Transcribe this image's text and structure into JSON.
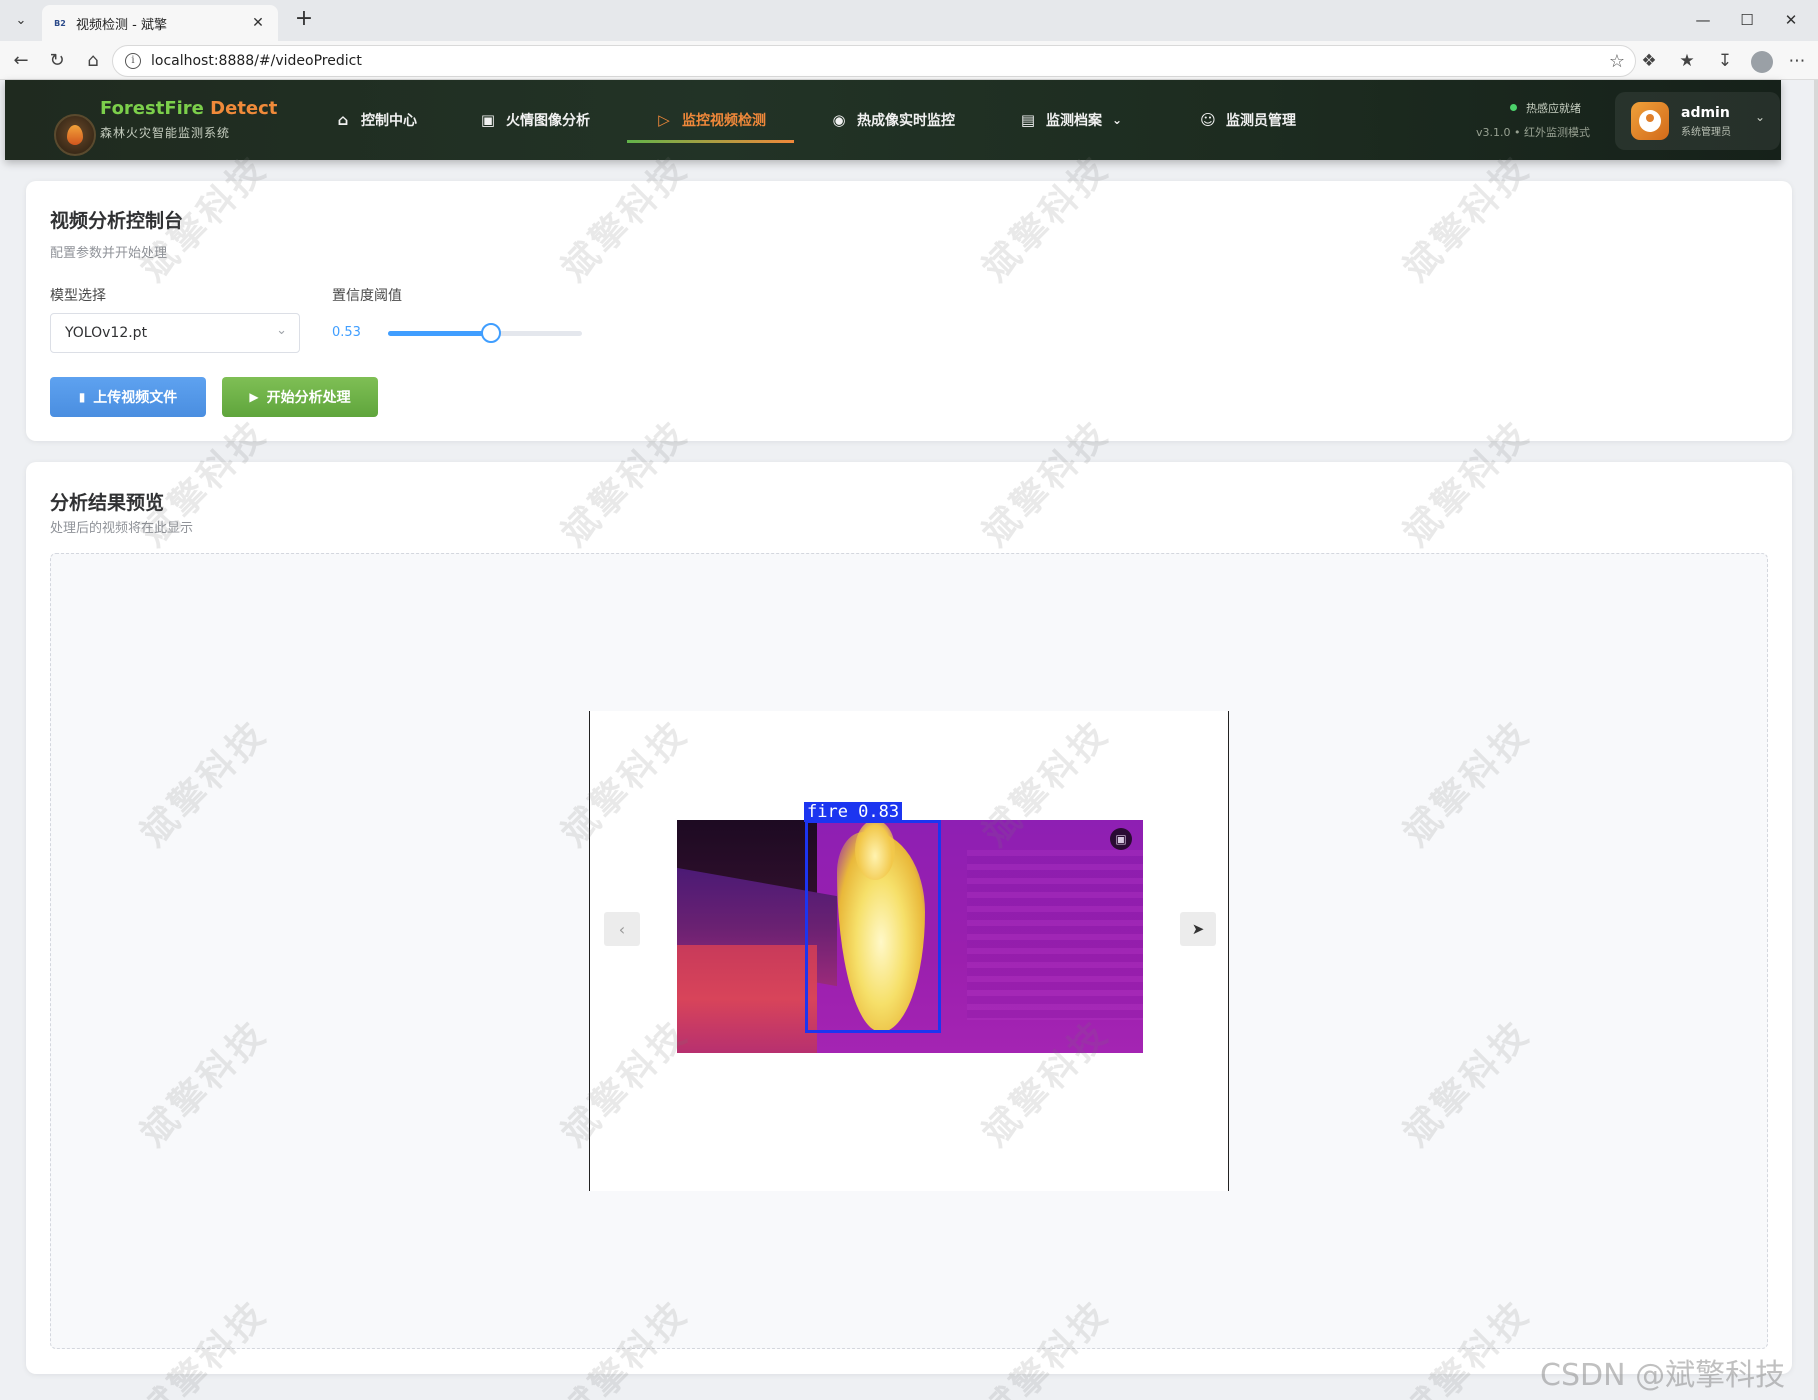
{
  "browser": {
    "tab_title": "视频检测 - 斌擎",
    "favicon_text": "B2",
    "url": "localhost:8888/#/videoPredict"
  },
  "brand": {
    "title_part1": "ForestFire",
    "title_part2": "Detect",
    "subtitle": "森林火灾智能监测系统"
  },
  "nav": {
    "items": [
      {
        "label": "控制中心",
        "icon": "home-icon"
      },
      {
        "label": "火情图像分析",
        "icon": "image-icon"
      },
      {
        "label": "监控视频检测",
        "icon": "video-play-icon",
        "active": true
      },
      {
        "label": "热成像实时监控",
        "icon": "camera-icon"
      },
      {
        "label": "监测档案",
        "icon": "document-icon",
        "has_dropdown": true
      },
      {
        "label": "监测员管理",
        "icon": "user-icon"
      }
    ]
  },
  "status": {
    "text": "热感应就绪",
    "version": "v3.1.0 • 红外监测模式"
  },
  "user": {
    "name": "admin",
    "role": "系统管理员"
  },
  "control_panel": {
    "title": "视频分析控制台",
    "subtitle": "配置参数并开始处理",
    "model_label": "模型选择",
    "model_value": "YOLOv12.pt",
    "confidence_label": "置信度阈值",
    "confidence_value": "0.53",
    "confidence_fraction": 0.53,
    "upload_button": "上传视频文件",
    "start_button": "开始分析处理"
  },
  "result_panel": {
    "title": "分析结果预览",
    "subtitle": "处理后的视频将在此显示"
  },
  "detection": {
    "label": "fire 0.83"
  },
  "watermark": {
    "text": "斌擎科技",
    "footer": "CSDN @斌擎科技"
  },
  "colors": {
    "accent_active": "#f0883a",
    "brand_green": "#7ccf4b",
    "primary_blue": "#409eff",
    "upload_blue": "#4a8ee0",
    "start_green": "#5fa53c",
    "detection_box": "#1c35f0"
  }
}
